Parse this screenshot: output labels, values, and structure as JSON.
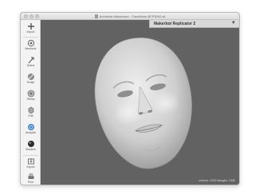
{
  "window": {
    "title": "Autodesk Meshmixer - FaceMesh-BFP3092.stl"
  },
  "sidebar": {
    "items": [
      {
        "label": "Import",
        "icon": "import-icon"
      },
      {
        "label": "Meshmix",
        "icon": "meshmix-icon"
      },
      {
        "label": "Select",
        "icon": "select-icon"
      },
      {
        "label": "Sculpt",
        "icon": "sculpt-icon"
      },
      {
        "label": "Stamp",
        "icon": "stamp-icon"
      },
      {
        "label": "Edit",
        "icon": "edit-icon"
      },
      {
        "label": "Analysis",
        "icon": "analysis-icon"
      },
      {
        "label": "Shaders",
        "icon": "shaders-icon"
      },
      {
        "label": "Export",
        "icon": "export-icon"
      },
      {
        "label": "Print",
        "icon": "print-icon"
      }
    ]
  },
  "viewport": {
    "printer": "Makerbot Replicator 2",
    "printer_caret": "▼",
    "status": "vertices: 1230 triangles: 2456"
  }
}
